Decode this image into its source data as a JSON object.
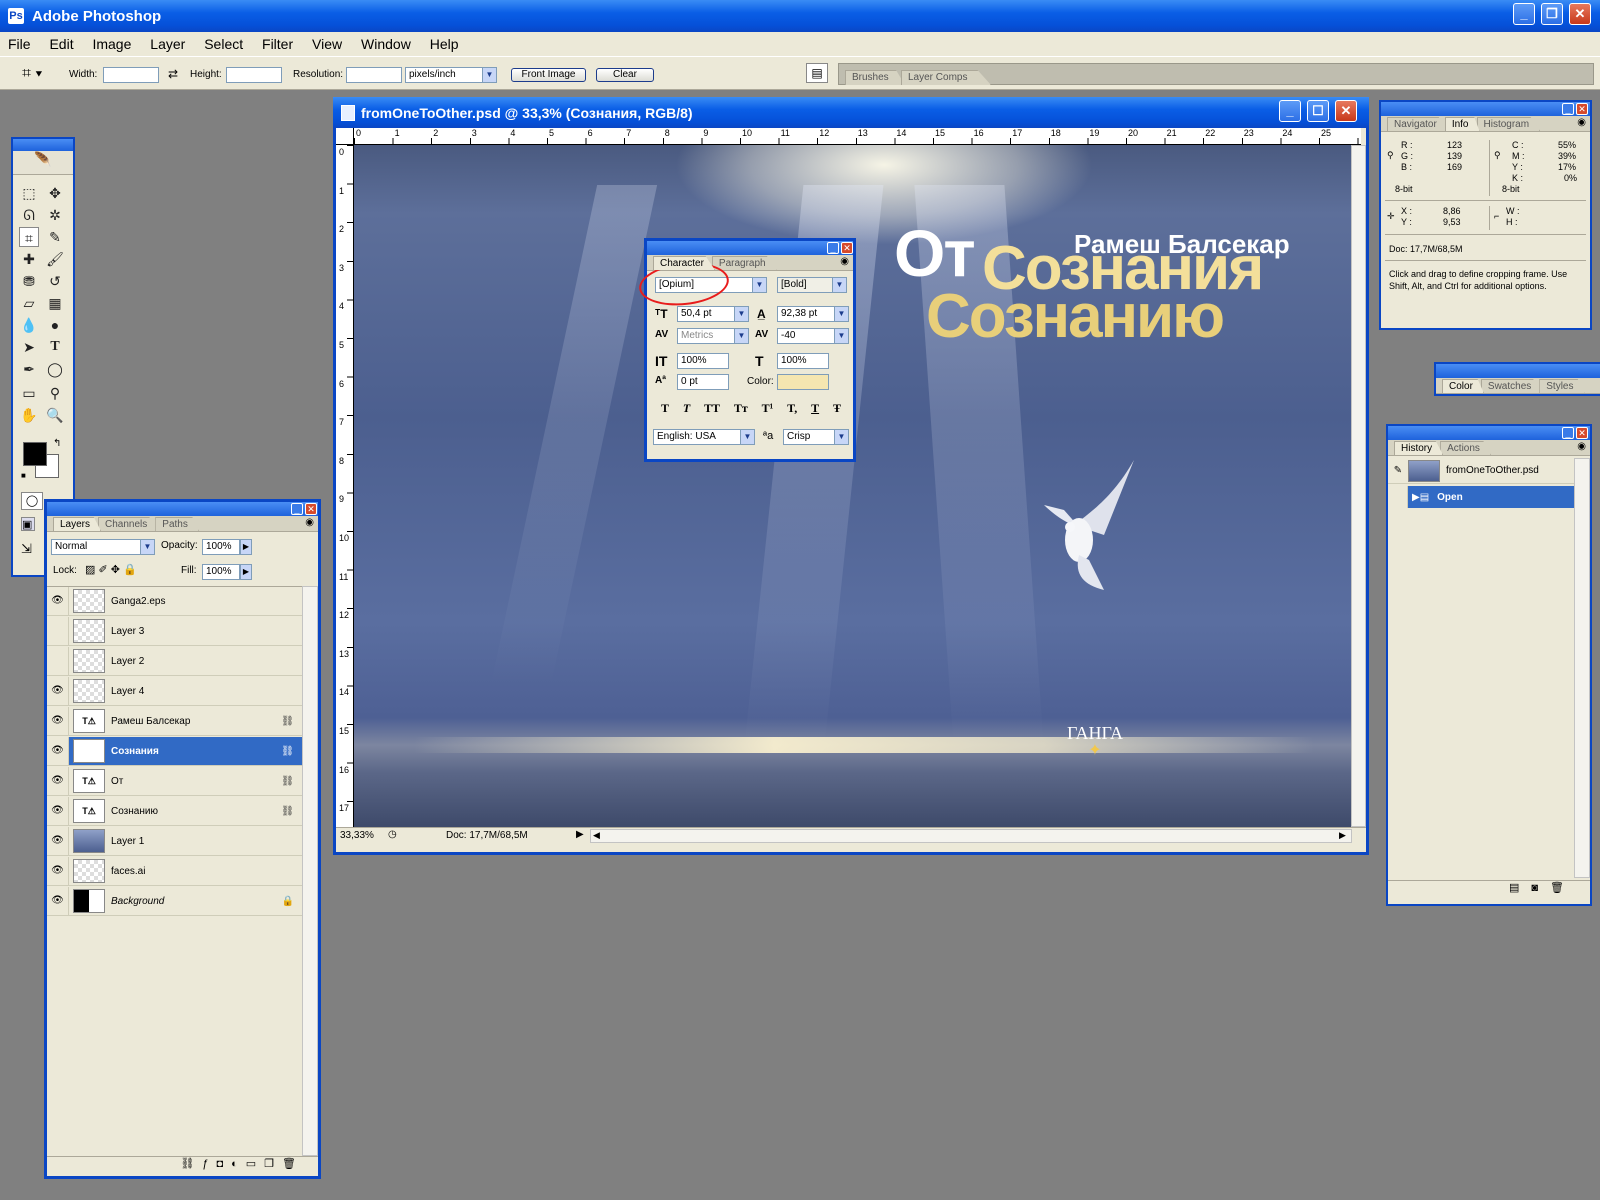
{
  "app": {
    "title": "Adobe Photoshop"
  },
  "menu": [
    "File",
    "Edit",
    "Image",
    "Layer",
    "Select",
    "Filter",
    "View",
    "Window",
    "Help"
  ],
  "options_bar": {
    "width_label": "Width:",
    "height_label": "Height:",
    "resolution_label": "Resolution:",
    "units": "pixels/inch",
    "front_image": "Front Image",
    "clear": "Clear",
    "well_tabs": [
      "Brushes",
      "Layer Comps"
    ]
  },
  "document": {
    "title": "fromOneToOther.psd @ 33,3% (Сознания, RGB/8)",
    "zoom": "33,33%",
    "doc_size": "Doc: 17,7M/68,5M",
    "ruler_h": [
      "0",
      "1",
      "2",
      "3",
      "4",
      "5",
      "6",
      "7",
      "8",
      "9",
      "10",
      "11",
      "12",
      "13",
      "14",
      "15",
      "16",
      "17",
      "18",
      "19",
      "20",
      "21",
      "22",
      "23",
      "24",
      "25"
    ],
    "ruler_v": [
      "0",
      "1",
      "2",
      "3",
      "4",
      "5",
      "6",
      "7",
      "8",
      "9",
      "10",
      "11",
      "12",
      "13",
      "14",
      "15",
      "16",
      "17"
    ],
    "art": {
      "author": "Рамеш Балсекар",
      "word1": "От",
      "word2": "Сознания",
      "word3": "Сознанию",
      "logo": "ГАНГА"
    }
  },
  "character_panel": {
    "tabs": [
      "Character",
      "Paragraph"
    ],
    "font_family": "[Opium]",
    "font_style": "[Bold]",
    "size": "50,4 pt",
    "leading": "92,38 pt",
    "kerning": "Metrics",
    "tracking": "-40",
    "v_scale": "100%",
    "h_scale": "100%",
    "baseline": "0 pt",
    "color_label": "Color:",
    "color_value": "#f5e6b0",
    "style_buttons": [
      "T",
      "T",
      "TT",
      "Tт",
      "T¹",
      "T,",
      "T",
      "Ŧ"
    ],
    "language": "English: USA",
    "aa_label": "ªa",
    "antialias": "Crisp"
  },
  "layers_panel": {
    "tabs": [
      "Layers",
      "Channels",
      "Paths"
    ],
    "blend_mode": "Normal",
    "opacity_label": "Opacity:",
    "opacity": "100%",
    "lock_label": "Lock:",
    "fill_label": "Fill:",
    "fill": "100%",
    "layers": [
      {
        "name": "Ganga2.eps",
        "visible": true
      },
      {
        "name": "Layer 3",
        "visible": false
      },
      {
        "name": "Layer 2",
        "visible": false
      },
      {
        "name": "Layer 4",
        "visible": true
      },
      {
        "name": "Рамеш Балсекар",
        "visible": true,
        "text": true
      },
      {
        "name": "Сознания",
        "visible": true,
        "text": true,
        "selected": true
      },
      {
        "name": "От",
        "visible": true,
        "text": true
      },
      {
        "name": "Сознанию",
        "visible": true,
        "text": true
      },
      {
        "name": "Layer 1",
        "visible": true
      },
      {
        "name": "faces.ai",
        "visible": true
      },
      {
        "name": "Background",
        "visible": true,
        "locked": true
      }
    ]
  },
  "info_panel": {
    "tabs": [
      "Navigator",
      "Info",
      "Histogram"
    ],
    "r_label": "R :",
    "r": "123",
    "g_label": "G :",
    "g": "139",
    "b_label": "B :",
    "b": "169",
    "c_label": "C :",
    "c": "55%",
    "m_label": "M :",
    "m": "39%",
    "y_label": "Y :",
    "y": "17%",
    "k_label": "K :",
    "k": "0%",
    "bit_left": "8-bit",
    "bit_right": "8-bit",
    "x_label": "X :",
    "x": "8,86",
    "ylab": "Y :",
    "yv": "9,53",
    "w_label": "W :",
    "h_label": "H :",
    "doc": "Doc: 17,7M/68,5M",
    "hint": "Click and drag to define cropping frame. Use Shift, Alt, and Ctrl for additional options."
  },
  "color_panel": {
    "tabs": [
      "Color",
      "Swatches",
      "Styles"
    ]
  },
  "history_panel": {
    "tabs": [
      "History",
      "Actions"
    ],
    "snapshot": "fromOneToOther.psd",
    "step": "Open"
  }
}
